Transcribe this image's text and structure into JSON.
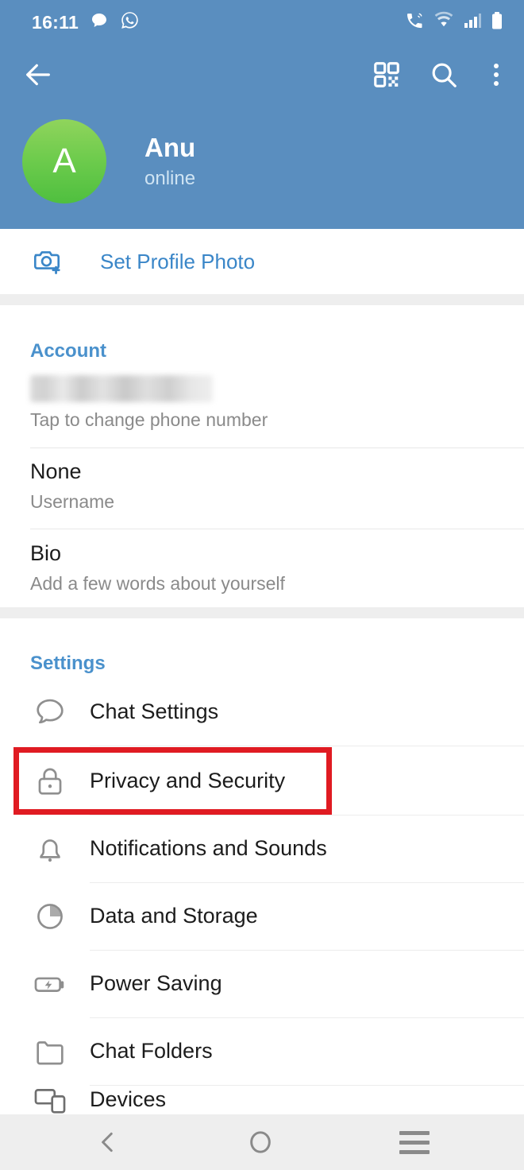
{
  "status_bar": {
    "time": "16:11",
    "left_icons": [
      "speech-bubble-icon",
      "whatsapp-icon"
    ],
    "right_icons": [
      "call-signal-icon",
      "wifi-icon",
      "cellular-signal-icon",
      "battery-icon"
    ]
  },
  "toolbar": {
    "back_label": "back-arrow",
    "qr_label": "qr-code",
    "search_label": "search",
    "overflow_label": "more-options"
  },
  "profile": {
    "avatar_initial": "A",
    "name": "Anu",
    "status": "online"
  },
  "set_profile_photo": {
    "label": "Set Profile Photo"
  },
  "account": {
    "title": "Account",
    "rows": [
      {
        "primary": "",
        "primary_redacted": true,
        "secondary": "Tap to change phone number"
      },
      {
        "primary": "None",
        "secondary": "Username"
      },
      {
        "primary": "Bio",
        "secondary": "Add a few words about yourself"
      }
    ]
  },
  "settings": {
    "title": "Settings",
    "items": [
      {
        "label": "Chat Settings",
        "icon": "speech-bubble-icon"
      },
      {
        "label": "Privacy and Security",
        "icon": "lock-icon",
        "highlighted": true
      },
      {
        "label": "Notifications and Sounds",
        "icon": "bell-icon"
      },
      {
        "label": "Data and Storage",
        "icon": "pie-chart-icon"
      },
      {
        "label": "Power Saving",
        "icon": "battery-bolt-icon"
      },
      {
        "label": "Chat Folders",
        "icon": "folder-icon"
      },
      {
        "label": "Devices",
        "icon": "devices-icon"
      }
    ]
  },
  "nav_bar": {
    "back_label": "back",
    "home_label": "home",
    "recents_label": "recent-apps"
  },
  "colors": {
    "header_blue": "#5a8ebf",
    "accent_blue": "#4a91cc",
    "link_blue": "#3a86c8",
    "annotation_red": "#e01b22",
    "avatar_green": "#6ccb4c",
    "divider_gray": "#eeeeee"
  }
}
